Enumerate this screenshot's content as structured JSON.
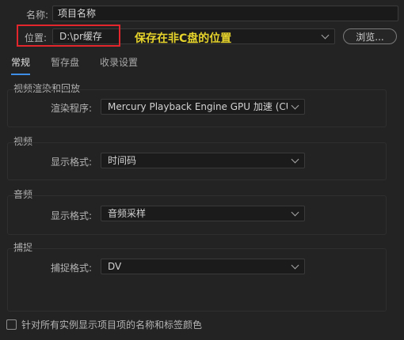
{
  "name_field": {
    "label": "名称:",
    "value": "项目名称"
  },
  "location": {
    "label": "位置:",
    "value": "D:\\pr缓存",
    "browse_label": "浏览..."
  },
  "annotation": {
    "text": "保存在非C盘的位置",
    "box_color": "#e2262b",
    "text_color": "#e6d32b"
  },
  "tabs": [
    {
      "label": "常规",
      "active": true
    },
    {
      "label": "暂存盘",
      "active": false
    },
    {
      "label": "收录设置",
      "active": false
    }
  ],
  "groups": {
    "render": {
      "title": "视频渲染和回放",
      "field_label": "渲染程序:",
      "value": "Mercury Playback Engine GPU 加速 (CUDA)"
    },
    "video": {
      "title": "视频",
      "field_label": "显示格式:",
      "value": "时间码"
    },
    "audio": {
      "title": "音频",
      "field_label": "显示格式:",
      "value": "音频采样"
    },
    "capture": {
      "title": "捕捉",
      "field_label": "捕捉格式:",
      "value": "DV"
    }
  },
  "checkbox": {
    "label": "针对所有实例显示项目项的名称和标签颜色",
    "checked": false
  },
  "colors": {
    "background": "#232323",
    "accent": "#3e8ee8"
  }
}
